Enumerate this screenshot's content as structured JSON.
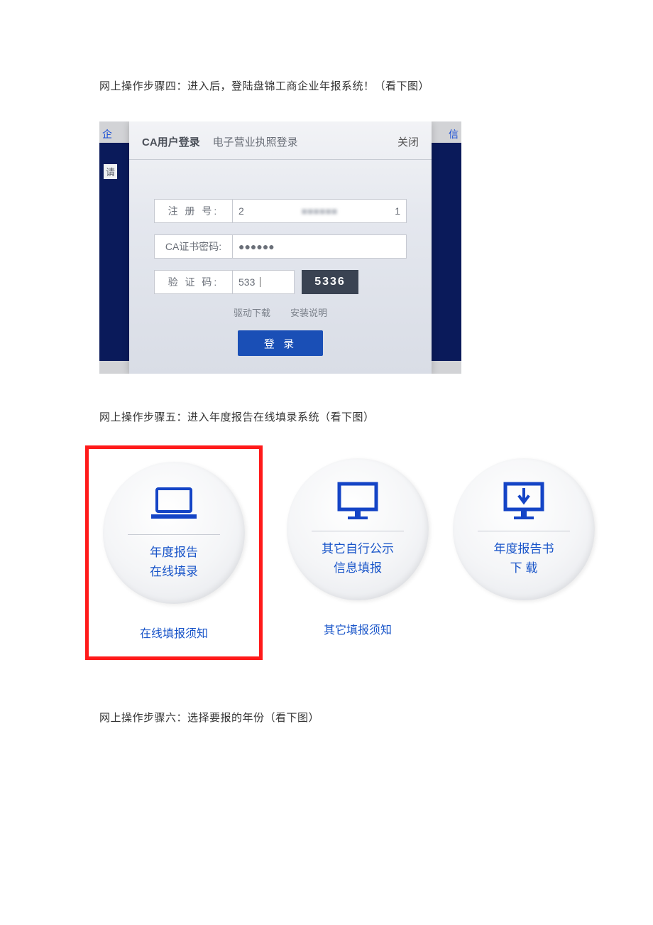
{
  "steps": {
    "four": "网上操作步骤四：进入后，登陆盘锦工商企业年报系统！（看下图）",
    "five": "网上操作步骤五：进入年度报告在线填录系统（看下图）",
    "six": "网上操作步骤六：选择要报的年份（看下图）"
  },
  "login": {
    "side_left": "企",
    "side_right": "信",
    "side_tag": "请",
    "tab_ca": "CA用户登录",
    "tab_license": "电子营业执照登录",
    "close": "关闭",
    "reg_label": "注 册 号:",
    "reg_value_prefix": "2",
    "reg_value_suffix": "1",
    "pw_label": "CA证书密码:",
    "pw_value": "●●●●●●",
    "captcha_label": "验 证 码:",
    "captcha_input": "533",
    "captcha_code": "5336",
    "link_driver": "驱动下载",
    "link_install": "安装说明",
    "login_btn": "登 录"
  },
  "options": {
    "opt1_line1": "年度报告",
    "opt1_line2": "在线填录",
    "opt1_notice": "在线填报须知",
    "opt2_line1": "其它自行公示",
    "opt2_line2": "信息填报",
    "opt2_notice": "其它填报须知",
    "opt3_line1": "年度报告书",
    "opt3_line2": "下 载"
  }
}
